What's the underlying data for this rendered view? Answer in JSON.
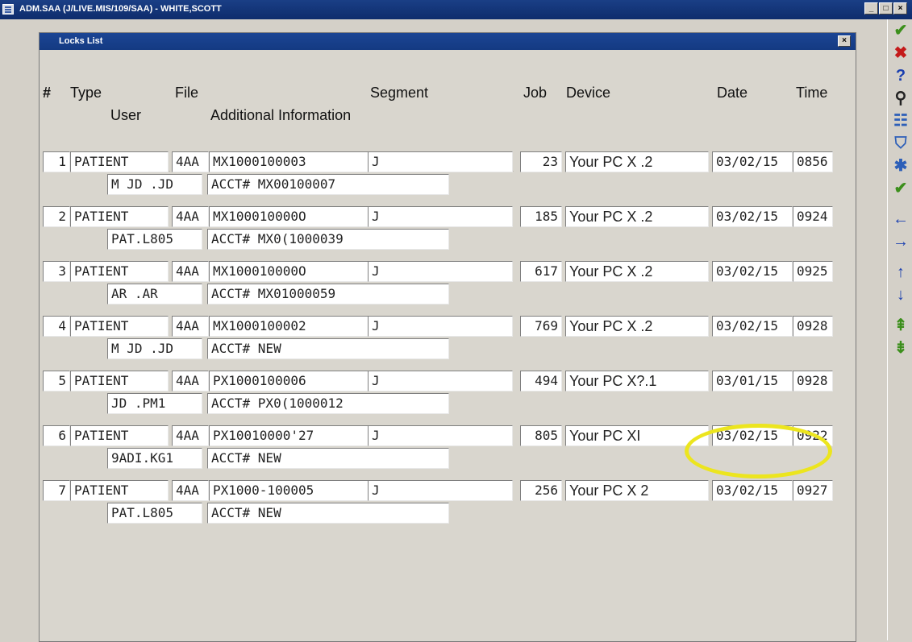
{
  "window": {
    "title": "ADM.SAA (J/LIVE.MIS/109/SAA) - WHITE,SCOTT",
    "minimize": "_",
    "maximize": "□",
    "close": "×"
  },
  "dialog": {
    "title": "Locks List",
    "close": "×"
  },
  "headers": {
    "num": "#",
    "type": "Type",
    "file": "File",
    "segment": "Segment",
    "job": "Job",
    "device": "Device",
    "date": "Date",
    "time": "Time",
    "user": "User",
    "additional": "Additional Information"
  },
  "records": [
    {
      "num": "1",
      "type": "PATIENT",
      "file": "4AA",
      "segment": "MX1000100003",
      "seg2": "J",
      "job": "23",
      "device": "Your PC X .2",
      "date": "03/02/15",
      "time": "0856",
      "user": "M JD .JD",
      "info": "ACCT# MX00100007"
    },
    {
      "num": "2",
      "type": "PATIENT",
      "file": "4AA",
      "segment": "MX100010000O",
      "seg2": "J",
      "job": "185",
      "device": "Your PC X .2",
      "date": "03/02/15",
      "time": "0924",
      "user": "PAT.L805",
      "info": "ACCT# MX0(1000039"
    },
    {
      "num": "3",
      "type": "PATIENT",
      "file": "4AA",
      "segment": "MX100010000O",
      "seg2": "J",
      "job": "617",
      "device": "Your PC X .2",
      "date": "03/02/15",
      "time": "0925",
      "user": "AR .AR",
      "info": "ACCT# MX01000059"
    },
    {
      "num": "4",
      "type": "PATIENT",
      "file": "4AA",
      "segment": "MX1000100002",
      "seg2": "J",
      "job": "769",
      "device": "Your PC X .2",
      "date": "03/02/15",
      "time": "0928",
      "user": "M JD .JD",
      "info": "ACCT# NEW"
    },
    {
      "num": "5",
      "type": "PATIENT",
      "file": "4AA",
      "segment": "PX1000100006",
      "seg2": "J",
      "job": "494",
      "device": "Your PC X?.1",
      "date": "03/01/15",
      "time": "0928",
      "user": "JD .PM1",
      "info": "ACCT# PX0(1000012"
    },
    {
      "num": "6",
      "type": "PATIENT",
      "file": "4AA",
      "segment": "PX10010000'27",
      "seg2": "J",
      "job": "805",
      "device": "Your PC XI",
      "date": "03/02/15",
      "time": "0922",
      "user": "9ADI.KG1",
      "info": "ACCT# NEW"
    },
    {
      "num": "7",
      "type": "PATIENT",
      "file": "4AA",
      "segment": "PX1000-100005",
      "seg2": "J",
      "job": "256",
      "device": "Your PC X 2",
      "date": "03/02/15",
      "time": "0927",
      "user": "PAT.L805",
      "info": "ACCT# NEW"
    }
  ],
  "toolbar": [
    {
      "name": "ok-check-icon",
      "glyph": "✔",
      "color": "#3c8f1c"
    },
    {
      "name": "cancel-x-icon",
      "glyph": "✖",
      "color": "#c41a1a"
    },
    {
      "name": "help-question-icon",
      "glyph": "?",
      "color": "#1a3fb0"
    },
    {
      "name": "binoculars-icon",
      "glyph": "⚲",
      "color": "#222222"
    },
    {
      "name": "list-delete-icon",
      "glyph": "☷",
      "color": "#2d5fb8"
    },
    {
      "name": "filter-icon",
      "glyph": "⛉",
      "color": "#2d5fb8"
    },
    {
      "name": "asterisk-icon",
      "glyph": "✱",
      "color": "#2d5fb8"
    },
    {
      "name": "check-all-icon",
      "glyph": "✔",
      "color": "#3c8f1c"
    },
    {
      "name": "arrow-left-icon",
      "glyph": "←",
      "color": "#1a3fb0"
    },
    {
      "name": "arrow-right-icon",
      "glyph": "→",
      "color": "#1a3fb0"
    },
    {
      "name": "arrow-up-icon",
      "glyph": "↑",
      "color": "#1a3fb0"
    },
    {
      "name": "arrow-down-icon",
      "glyph": "↓",
      "color": "#1a3fb0"
    },
    {
      "name": "page-up-icon",
      "glyph": "⇞",
      "color": "#3c8f1c"
    },
    {
      "name": "page-down-icon",
      "glyph": "⇟",
      "color": "#3c8f1c"
    }
  ],
  "colors": {
    "titlebar": "#143a82",
    "highlight": "#ece51e",
    "field_bg": "#ffffff",
    "background": "#d9d6ce"
  }
}
